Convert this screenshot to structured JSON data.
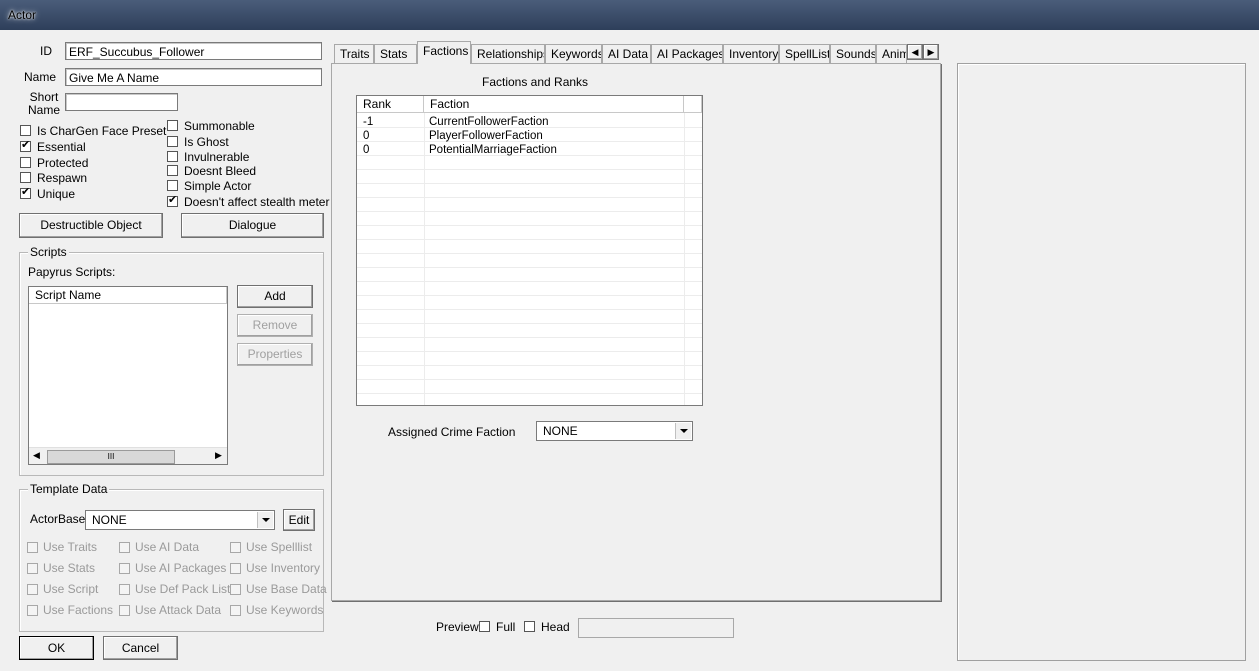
{
  "window": {
    "title": "Actor"
  },
  "fields": {
    "id_label": "ID",
    "id_value": "ERF_Succubus_Follower",
    "name_label": "Name",
    "name_value": "Give Me A Name",
    "short_name_label": "Short\nName",
    "short_name_value": ""
  },
  "flags_left": [
    {
      "label": "Is CharGen Face Preset",
      "checked": false
    },
    {
      "label": "Essential",
      "checked": true
    },
    {
      "label": "Protected",
      "checked": false
    },
    {
      "label": "Respawn",
      "checked": false
    },
    {
      "label": "Unique",
      "checked": true
    }
  ],
  "flags_right": [
    {
      "label": "Summonable",
      "checked": false
    },
    {
      "label": "Is Ghost",
      "checked": false
    },
    {
      "label": "Invulnerable",
      "checked": false
    },
    {
      "label": "Doesnt Bleed",
      "checked": false
    },
    {
      "label": "Simple Actor",
      "checked": false
    },
    {
      "label": "Doesn't affect stealth meter",
      "checked": true
    }
  ],
  "buttons": {
    "destructible": "Destructible Object",
    "dialogue": "Dialogue",
    "add": "Add",
    "remove": "Remove",
    "properties": "Properties",
    "edit": "Edit",
    "ok": "OK",
    "cancel": "Cancel"
  },
  "scripts": {
    "group_title": "Scripts",
    "papyrus_label": "Papyrus Scripts:",
    "column": "Script Name",
    "scroll_thumb": "III"
  },
  "template": {
    "group_title": "Template Data",
    "actorbase_label": "ActorBase",
    "actorbase_value": "NONE",
    "options": [
      [
        "Use Traits",
        "Use AI Data",
        "Use Spelllist"
      ],
      [
        "Use Stats",
        "Use AI Packages",
        "Use Inventory"
      ],
      [
        "Use Script",
        "Use Def Pack List",
        "Use Base Data"
      ],
      [
        "Use Factions",
        "Use Attack Data",
        "Use Keywords"
      ]
    ]
  },
  "tabs": [
    "Traits",
    "Stats",
    "Factions",
    "Relationships",
    "Keywords",
    "AI Data",
    "AI Packages",
    "Inventory",
    "SpellList",
    "Sounds",
    "Anim"
  ],
  "active_tab": "Factions",
  "factions": {
    "heading": "Factions and Ranks",
    "columns": [
      "Rank",
      "Faction"
    ],
    "rows": [
      {
        "rank": "-1",
        "faction": "CurrentFollowerFaction"
      },
      {
        "rank": "0",
        "faction": "PlayerFollowerFaction"
      },
      {
        "rank": "0",
        "faction": "PotentialMarriageFaction"
      }
    ],
    "crime_label": "Assigned Crime Faction",
    "crime_value": "NONE"
  },
  "preview": {
    "label": "Preview",
    "full_label": "Full",
    "head_label": "Head"
  }
}
